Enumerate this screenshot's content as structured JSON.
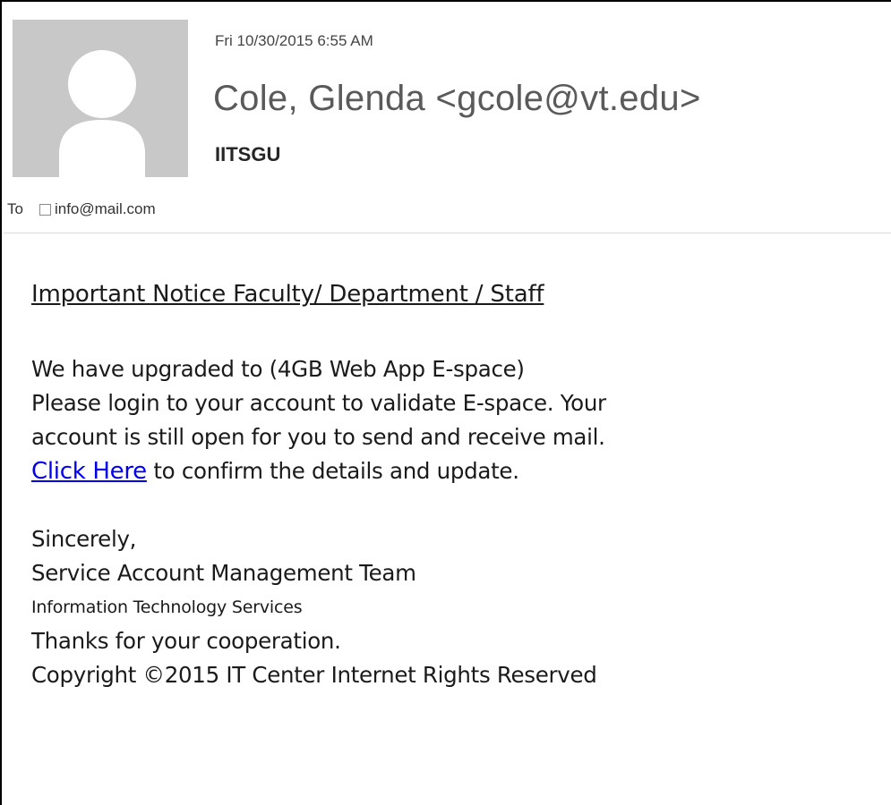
{
  "header": {
    "avatar_icon": "person-silhouette-icon",
    "date": "Fri 10/30/2015 6:55 AM",
    "sender": "Cole, Glenda <gcole@vt.edu>",
    "subject": "IITSGU",
    "to_label": "To",
    "recipient": "info@mail.com"
  },
  "message": {
    "notice_heading": "Important Notice Faculty/ Department / Staff ",
    "line1": "We have upgraded to (4GB Web App E-space)",
    "line2": "Please login to your account to validate E-space. Your",
    "line3": "account is still open for you to send and receive mail.",
    "link_text": "Click Here",
    "line4_rest": " to confirm the details and update.",
    "closing": "Sincerely,",
    "team": "Service Account Management Team",
    "department": "Information Technology Services",
    "thanks": "Thanks for your cooperation.",
    "copyright": "Copyright ©2015 IT Center Internet Rights Reserved"
  },
  "colors": {
    "link": "#0000ee",
    "avatar_bg": "#c8c8c8",
    "avatar_fg": "#ffffff"
  }
}
